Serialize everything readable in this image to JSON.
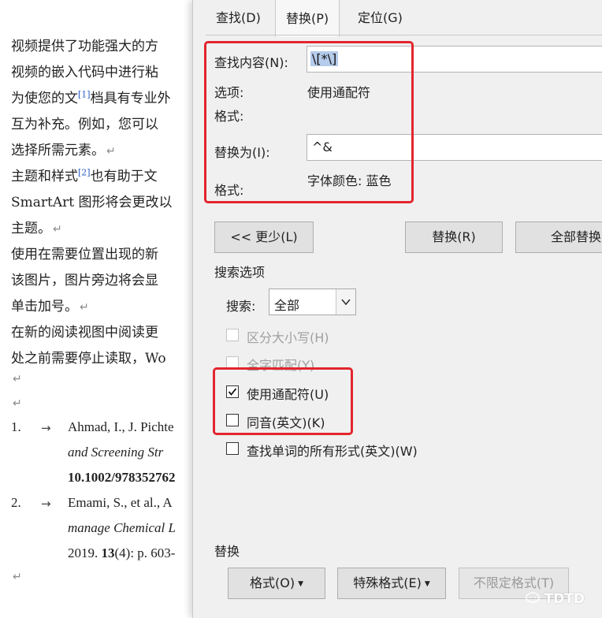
{
  "document": {
    "lines": [
      "视频提供了功能强大的方",
      "视频的嵌入代码中进行粘",
      "为使您的文",
      "互为补充。例如，您可以",
      "选择所需元素。",
      "主题和样式",
      "SmartArt 图形将会更改以",
      "主题。",
      "使用在需要位置出现的新",
      "该图片，图片旁边将会显",
      "单击加号。",
      "在新的阅读视图中阅读更",
      "处之前需要停止读取，Wo"
    ],
    "line3_sup": "[1]",
    "line3_tail": "档具有专业外",
    "line6_sup": "[2]",
    "line6_tail": "也有助于文",
    "para_mark": "↵",
    "ref1_num": "1.",
    "ref1_line1": "Ahmad, I., J. Pichte",
    "ref1_line2": "and Screening Str",
    "ref1_line3": "10.1002/978352762",
    "ref2_num": "2.",
    "ref2_line1": "Emami, S., et al., A",
    "ref2_line2": "manage Chemical L",
    "ref2_line3a": "2019. ",
    "ref2_line3b": "13",
    "ref2_line3c": "(4): p. 603-",
    "arrow": "→"
  },
  "dialog": {
    "tabs": [
      "查找(D)",
      "替换(P)",
      "定位(G)"
    ],
    "active_tab": "替换(P)",
    "find_label": "查找内容(N):",
    "find_value": "\\[*\\]",
    "options_label": "选项:",
    "options_value": "使用通配符",
    "format_label": "格式:",
    "replace_label": "替换为(I):",
    "replace_value": "^&",
    "replace_format_label": "格式:",
    "replace_format_value": "字体颜色: 蓝色",
    "less_button": "<< 更少(L)",
    "replace_button": "替换(R)",
    "replace_all_button": "全部替换",
    "search_options_title": "搜索选项",
    "search_label": "搜索:",
    "search_value": "全部",
    "checkboxes": [
      {
        "label": "区分大小写(H)",
        "checked": false,
        "disabled": true
      },
      {
        "label": "全字匹配(Y)",
        "checked": false,
        "disabled": true
      },
      {
        "label": "使用通配符(U)",
        "checked": true,
        "disabled": false
      },
      {
        "label": "同音(英文)(K)",
        "checked": false,
        "disabled": false
      },
      {
        "label": "查找单词的所有形式(英文)(W)",
        "checked": false,
        "disabled": false
      }
    ],
    "replace_section_title": "替换",
    "format_button": "格式(O)",
    "special_button": "特殊格式(E)",
    "no_format_button": "不限定格式(T)"
  },
  "watermark": "TDTD",
  "colors": {
    "highlight_box": "#e3262e",
    "selection": "#b5cbeb",
    "dialog_bg": "#f0f0f0"
  }
}
